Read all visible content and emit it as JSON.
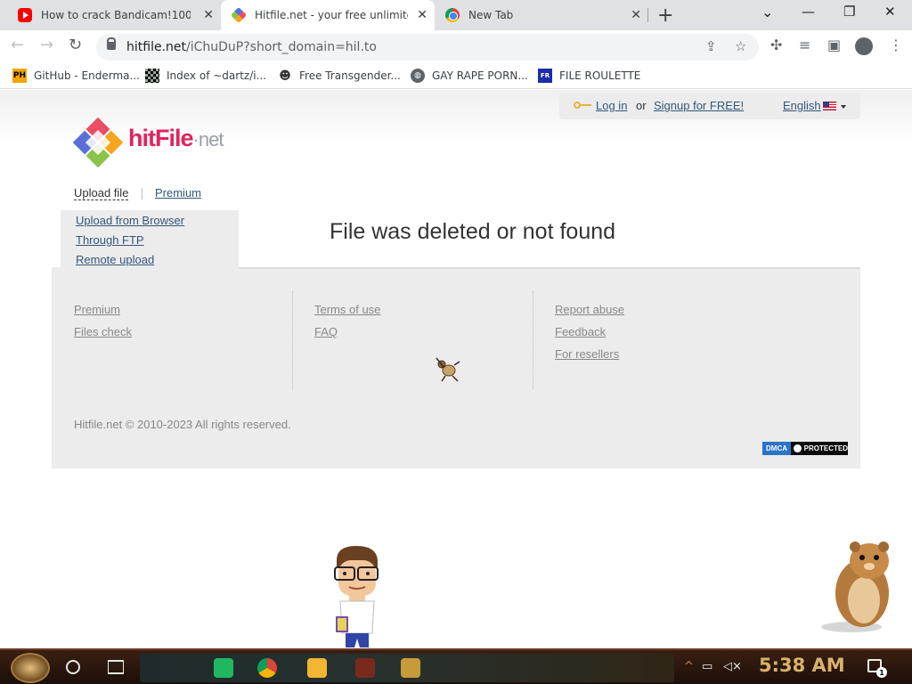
{
  "tabs": [
    {
      "title": "How to crack Bandicam!100% [",
      "favicon": "youtube-icon",
      "active": false
    },
    {
      "title": "Hitfile.net - your free unlimite",
      "favicon": "hitfile-icon",
      "active": true
    },
    {
      "title": "New Tab",
      "favicon": "chrome-icon",
      "active": false
    }
  ],
  "window_controls": {
    "tab_search": "⌄",
    "minimize": "—",
    "restore": "❐",
    "close": "✕"
  },
  "address": {
    "domain": "hitfile.net",
    "path": "/iChuDuP?short_domain=hil.to"
  },
  "bookmarks": [
    {
      "label": "GitHub - Enderma...",
      "icon": "ph-icon"
    },
    {
      "label": "Index of ~dartz/i...",
      "icon": "pixel-icon"
    },
    {
      "label": "Free Transgender...",
      "icon": "mask-icon"
    },
    {
      "label": "GAY RAPE PORN...",
      "icon": "globe-icon"
    },
    {
      "label": "FILE ROULETTE",
      "icon": "file-roulette-icon"
    }
  ],
  "header": {
    "login": "Log in",
    "or": "or",
    "signup": "Signup for FREE!",
    "language": "English"
  },
  "logo": {
    "part1": "hit",
    "part2": "File",
    "part3": "·net"
  },
  "menu": {
    "upload": "Upload file",
    "premium": "Premium"
  },
  "submenu": [
    "Upload from Browser",
    "Through FTP",
    "Remote upload"
  ],
  "message": "File was deleted or not found",
  "footer": {
    "col1": [
      "Premium",
      "Files check"
    ],
    "col2": [
      "Terms of use",
      "FAQ"
    ],
    "col3": [
      "Report abuse",
      "Feedback",
      "For resellers"
    ],
    "copyright": "Hitfile.net © 2010-2023 All rights reserved.",
    "dmca_left": "DMCA",
    "dmca_right": "PROTECTED"
  },
  "taskbar": {
    "clock": "5:38 AM",
    "notifications": "1"
  },
  "colors": {
    "link": "#33567c",
    "footer_link": "#888888",
    "brand": "#e0245e",
    "clock": "#d9b26a"
  }
}
